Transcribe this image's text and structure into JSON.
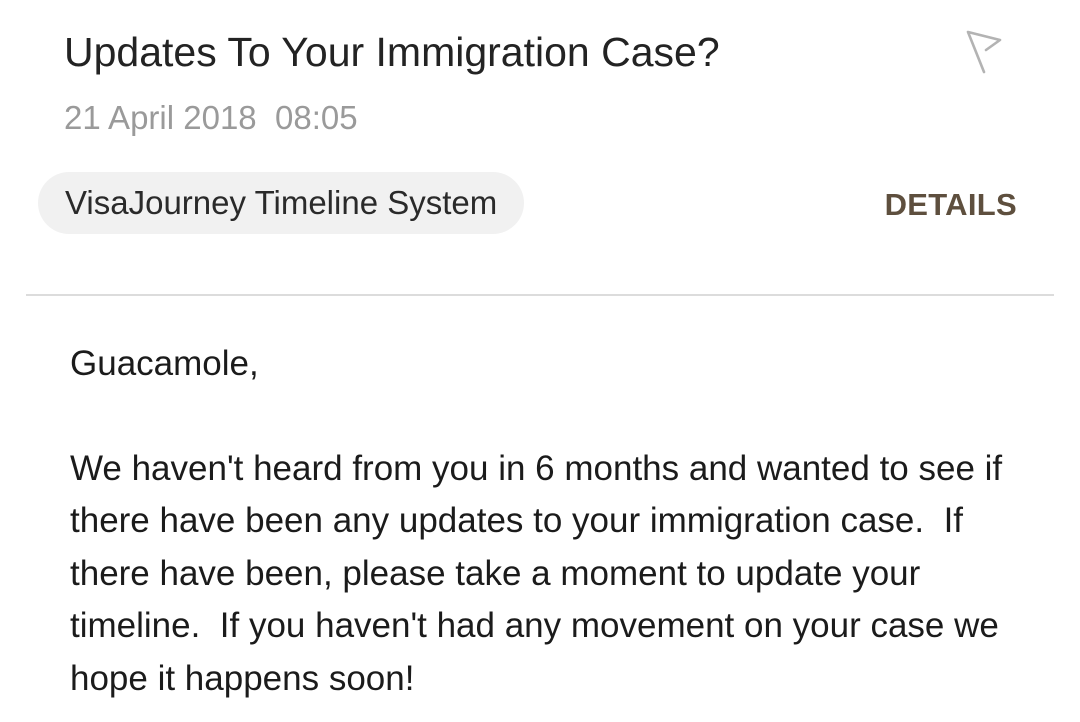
{
  "email": {
    "subject": "Updates To Your Immigration Case?",
    "timestamp": "21 April 2018  08:05",
    "sender": "VisaJourney Timeline System",
    "details_label": "DETAILS",
    "flag_icon": "flag-outline-icon",
    "greeting": "Guacamole,",
    "body": "We haven't heard from you in 6 months and wanted to see if there have been any updates to your immigration case.  If there have been, please take a moment to update your timeline.  If you haven't had any movement on your case we hope it happens soon!"
  },
  "colors": {
    "details_label": "#5e4f3e",
    "timestamp": "#9a9a9a",
    "sender_chip_bg": "#f1f1f1",
    "divider": "#dcdcdc"
  }
}
